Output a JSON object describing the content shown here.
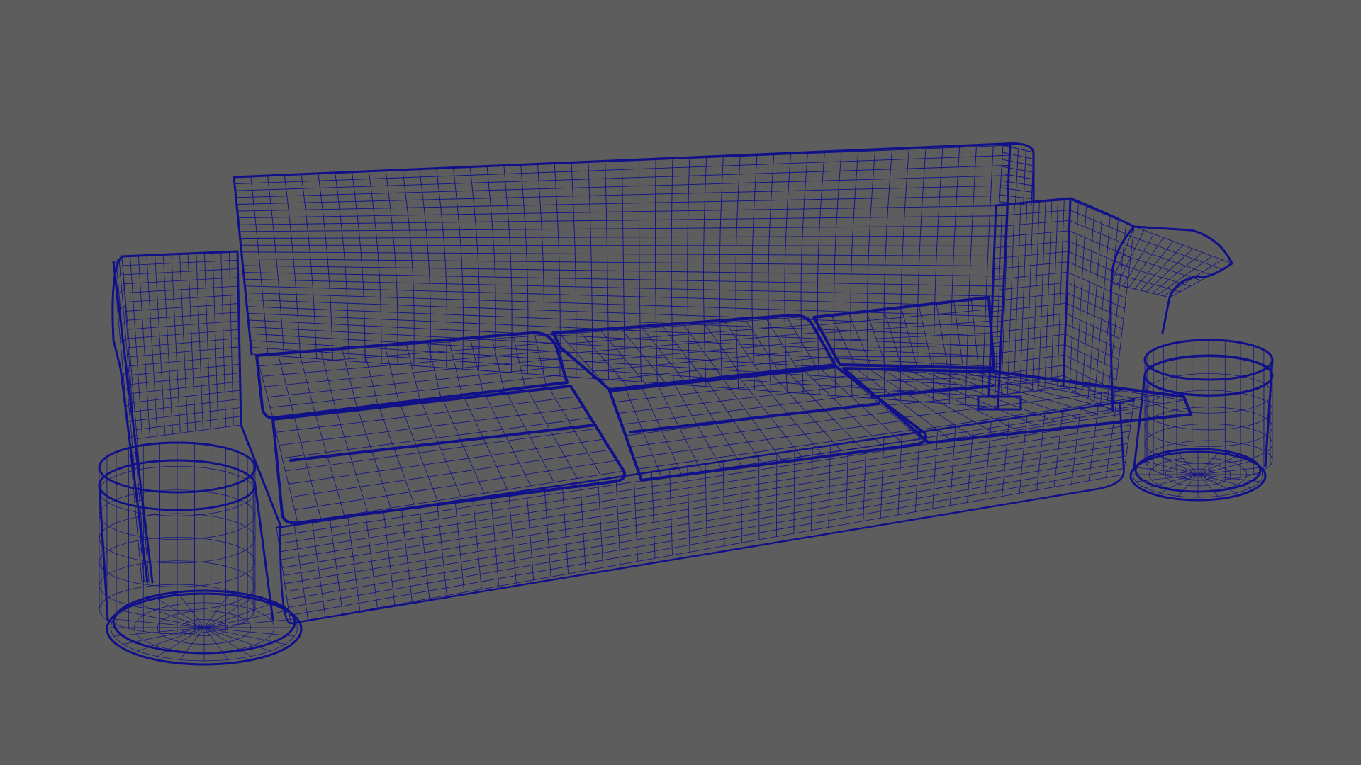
{
  "viewport": {
    "background_color": "#5d5d5d",
    "wire_color": "#10108a",
    "display_mode": "wireframe",
    "subject": "sofa"
  }
}
